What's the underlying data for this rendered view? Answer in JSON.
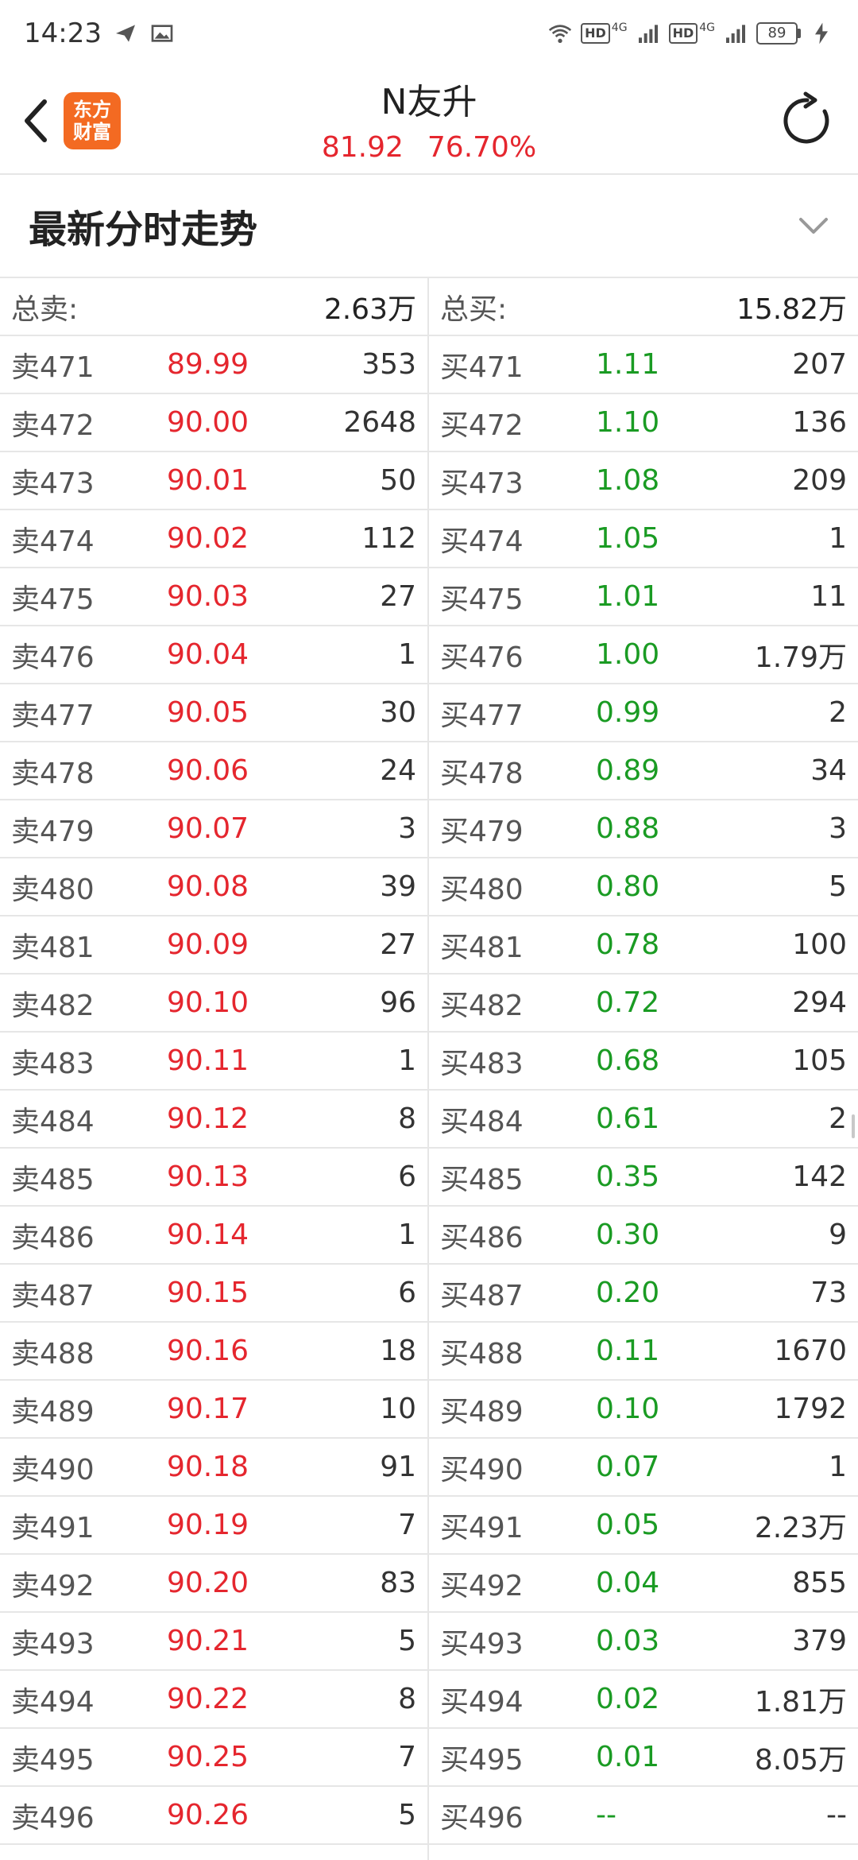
{
  "status": {
    "time": "14:23",
    "battery": "89",
    "net1": "4G",
    "net2": "4G",
    "hd1": "HD",
    "hd2": "HD"
  },
  "header": {
    "logo_line1": "东方",
    "logo_line2": "财富",
    "stock_name": "N友升",
    "price": "81.92",
    "change_pct": "76.70%"
  },
  "section": {
    "title": "最新分时走势"
  },
  "totals": {
    "sell_label": "总卖:",
    "sell_value": "2.63万",
    "buy_label": "总买:",
    "buy_value": "15.82万"
  },
  "sell": [
    {
      "label": "卖471",
      "price": "89.99",
      "volume": "353"
    },
    {
      "label": "卖472",
      "price": "90.00",
      "volume": "2648"
    },
    {
      "label": "卖473",
      "price": "90.01",
      "volume": "50"
    },
    {
      "label": "卖474",
      "price": "90.02",
      "volume": "112"
    },
    {
      "label": "卖475",
      "price": "90.03",
      "volume": "27"
    },
    {
      "label": "卖476",
      "price": "90.04",
      "volume": "1"
    },
    {
      "label": "卖477",
      "price": "90.05",
      "volume": "30"
    },
    {
      "label": "卖478",
      "price": "90.06",
      "volume": "24"
    },
    {
      "label": "卖479",
      "price": "90.07",
      "volume": "3"
    },
    {
      "label": "卖480",
      "price": "90.08",
      "volume": "39"
    },
    {
      "label": "卖481",
      "price": "90.09",
      "volume": "27"
    },
    {
      "label": "卖482",
      "price": "90.10",
      "volume": "96"
    },
    {
      "label": "卖483",
      "price": "90.11",
      "volume": "1"
    },
    {
      "label": "卖484",
      "price": "90.12",
      "volume": "8"
    },
    {
      "label": "卖485",
      "price": "90.13",
      "volume": "6"
    },
    {
      "label": "卖486",
      "price": "90.14",
      "volume": "1"
    },
    {
      "label": "卖487",
      "price": "90.15",
      "volume": "6"
    },
    {
      "label": "卖488",
      "price": "90.16",
      "volume": "18"
    },
    {
      "label": "卖489",
      "price": "90.17",
      "volume": "10"
    },
    {
      "label": "卖490",
      "price": "90.18",
      "volume": "91"
    },
    {
      "label": "卖491",
      "price": "90.19",
      "volume": "7"
    },
    {
      "label": "卖492",
      "price": "90.20",
      "volume": "83"
    },
    {
      "label": "卖493",
      "price": "90.21",
      "volume": "5"
    },
    {
      "label": "卖494",
      "price": "90.22",
      "volume": "8"
    },
    {
      "label": "卖495",
      "price": "90.25",
      "volume": "7"
    },
    {
      "label": "卖496",
      "price": "90.26",
      "volume": "5"
    }
  ],
  "buy": [
    {
      "label": "买471",
      "price": "1.11",
      "volume": "207"
    },
    {
      "label": "买472",
      "price": "1.10",
      "volume": "136"
    },
    {
      "label": "买473",
      "price": "1.08",
      "volume": "209"
    },
    {
      "label": "买474",
      "price": "1.05",
      "volume": "1"
    },
    {
      "label": "买475",
      "price": "1.01",
      "volume": "11"
    },
    {
      "label": "买476",
      "price": "1.00",
      "volume": "1.79万"
    },
    {
      "label": "买477",
      "price": "0.99",
      "volume": "2"
    },
    {
      "label": "买478",
      "price": "0.89",
      "volume": "34"
    },
    {
      "label": "买479",
      "price": "0.88",
      "volume": "3"
    },
    {
      "label": "买480",
      "price": "0.80",
      "volume": "5"
    },
    {
      "label": "买481",
      "price": "0.78",
      "volume": "100"
    },
    {
      "label": "买482",
      "price": "0.72",
      "volume": "294"
    },
    {
      "label": "买483",
      "price": "0.68",
      "volume": "105"
    },
    {
      "label": "买484",
      "price": "0.61",
      "volume": "2"
    },
    {
      "label": "买485",
      "price": "0.35",
      "volume": "142"
    },
    {
      "label": "买486",
      "price": "0.30",
      "volume": "9"
    },
    {
      "label": "买487",
      "price": "0.20",
      "volume": "73"
    },
    {
      "label": "买488",
      "price": "0.11",
      "volume": "1670"
    },
    {
      "label": "买489",
      "price": "0.10",
      "volume": "1792"
    },
    {
      "label": "买490",
      "price": "0.07",
      "volume": "1"
    },
    {
      "label": "买491",
      "price": "0.05",
      "volume": "2.23万"
    },
    {
      "label": "买492",
      "price": "0.04",
      "volume": "855"
    },
    {
      "label": "买493",
      "price": "0.03",
      "volume": "379"
    },
    {
      "label": "买494",
      "price": "0.02",
      "volume": "1.81万"
    },
    {
      "label": "买495",
      "price": "0.01",
      "volume": "8.05万"
    },
    {
      "label": "买496",
      "price": "--",
      "volume": "--"
    }
  ],
  "colors": {
    "up_red": "#e5262e",
    "down_green": "#1a9b23",
    "brand_orange": "#f36a22"
  }
}
